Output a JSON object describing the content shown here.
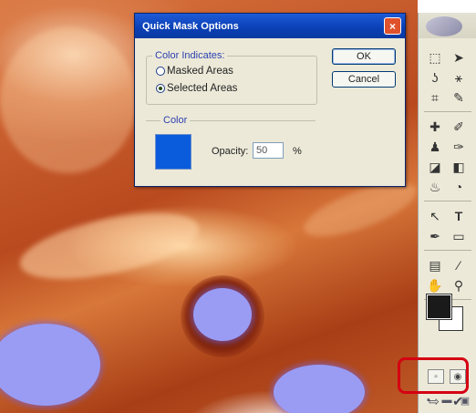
{
  "dialog": {
    "title": "Quick Mask Options",
    "close_glyph": "×",
    "color_indicates": {
      "legend": "Color Indicates:",
      "options": [
        {
          "label": "Masked Areas",
          "checked": false
        },
        {
          "label": "Selected Areas",
          "checked": true
        }
      ]
    },
    "color_group": {
      "legend": "Color",
      "swatch_color": "#0a5cdc",
      "opacity_label": "Opacity:",
      "opacity_value": "50",
      "opacity_unit": "%"
    },
    "ok_label": "OK",
    "cancel_label": "Cancel"
  },
  "toolbox": {
    "tools": [
      {
        "name": "marquee-tool",
        "glyph": "⬚"
      },
      {
        "name": "move-tool",
        "glyph": "➤"
      },
      {
        "name": "lasso-tool",
        "glyph": "ʖ"
      },
      {
        "name": "magic-wand-tool",
        "glyph": "⚹"
      },
      {
        "name": "crop-tool",
        "glyph": "⌗"
      },
      {
        "name": "slice-tool",
        "glyph": "✎"
      },
      {
        "name": "healing-brush-tool",
        "glyph": "✚"
      },
      {
        "name": "brush-tool",
        "glyph": "✐"
      },
      {
        "name": "clone-stamp-tool",
        "glyph": "♟"
      },
      {
        "name": "history-brush-tool",
        "glyph": "✑"
      },
      {
        "name": "eraser-tool",
        "glyph": "◪"
      },
      {
        "name": "paint-bucket-tool",
        "glyph": "◧"
      },
      {
        "name": "blur-tool",
        "glyph": "♨"
      },
      {
        "name": "dodge-tool",
        "glyph": "◔"
      },
      {
        "name": "path-selection-tool",
        "glyph": "↖"
      },
      {
        "name": "type-tool",
        "glyph": "T"
      },
      {
        "name": "pen-tool",
        "glyph": "✒"
      },
      {
        "name": "shape-tool",
        "glyph": "▭"
      },
      {
        "name": "notes-tool",
        "glyph": "▤"
      },
      {
        "name": "eyedropper-tool",
        "glyph": "⁄"
      },
      {
        "name": "hand-tool",
        "glyph": "✋"
      },
      {
        "name": "zoom-tool",
        "glyph": "⚲"
      }
    ],
    "foreground_color": "#1a1a1a",
    "background_color": "#ffffff",
    "standard_mode_glyph": "▫",
    "quick_mask_mode_glyph": "◉",
    "screen_modes": [
      "▪",
      "▬",
      "▣"
    ],
    "jump_glyph": "⇨",
    "check_glyph": "✔"
  },
  "colors": {
    "highlight": "#d40012"
  }
}
